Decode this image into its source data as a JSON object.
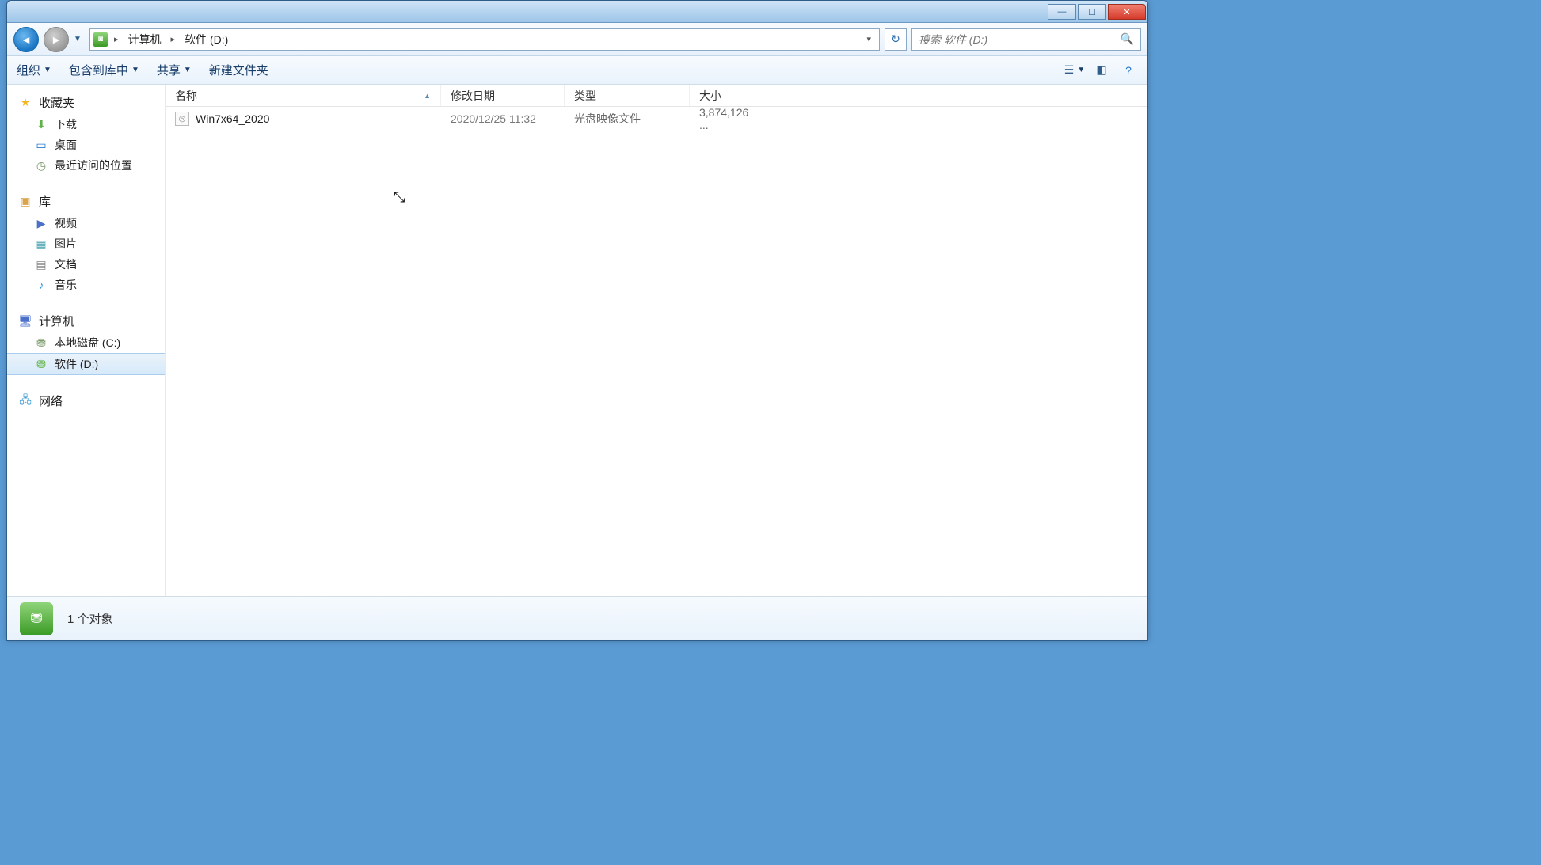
{
  "titlebar": {
    "min_glyph": "—",
    "max_glyph": "☐",
    "close_glyph": "✕"
  },
  "address": {
    "seg1": "计算机",
    "seg2": "软件 (D:)",
    "refresh_glyph": "↻"
  },
  "search": {
    "placeholder": "搜索 软件 (D:)"
  },
  "toolbar": {
    "organize": "组织",
    "add_to_library": "包含到库中",
    "share": "共享",
    "new_folder": "新建文件夹"
  },
  "sidebar": {
    "favorites": {
      "label": "收藏夹"
    },
    "downloads": {
      "label": "下载"
    },
    "desktop": {
      "label": "桌面"
    },
    "recent": {
      "label": "最近访问的位置"
    },
    "libraries": {
      "label": "库"
    },
    "videos": {
      "label": "视频"
    },
    "pictures": {
      "label": "图片"
    },
    "documents": {
      "label": "文档"
    },
    "music": {
      "label": "音乐"
    },
    "computer": {
      "label": "计算机"
    },
    "drive_c": {
      "label": "本地磁盘 (C:)"
    },
    "drive_d": {
      "label": "软件 (D:)"
    },
    "network": {
      "label": "网络"
    }
  },
  "columns": {
    "name": "名称",
    "date": "修改日期",
    "type": "类型",
    "size": "大小"
  },
  "files": [
    {
      "name": "Win7x64_2020",
      "date": "2020/12/25 11:32",
      "type": "光盘映像文件",
      "size": "3,874,126 ..."
    }
  ],
  "status": {
    "text": "1 个对象"
  }
}
